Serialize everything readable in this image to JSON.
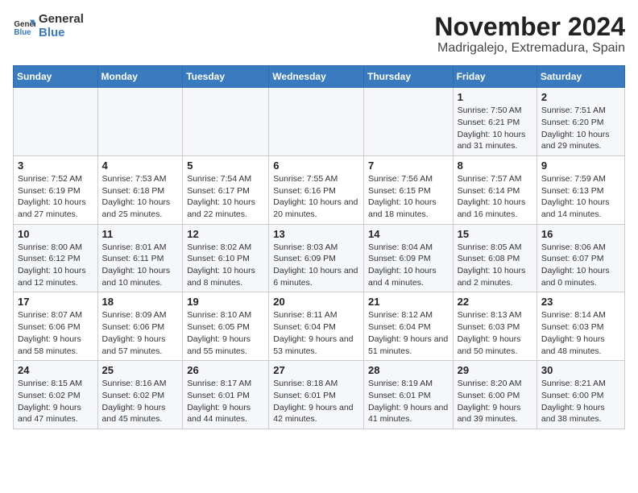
{
  "header": {
    "logo_general": "General",
    "logo_blue": "Blue",
    "title": "November 2024",
    "subtitle": "Madrigalejo, Extremadura, Spain"
  },
  "days_of_week": [
    "Sunday",
    "Monday",
    "Tuesday",
    "Wednesday",
    "Thursday",
    "Friday",
    "Saturday"
  ],
  "weeks": [
    [
      {
        "day": "",
        "info": ""
      },
      {
        "day": "",
        "info": ""
      },
      {
        "day": "",
        "info": ""
      },
      {
        "day": "",
        "info": ""
      },
      {
        "day": "",
        "info": ""
      },
      {
        "day": "1",
        "info": "Sunrise: 7:50 AM\nSunset: 6:21 PM\nDaylight: 10 hours and 31 minutes."
      },
      {
        "day": "2",
        "info": "Sunrise: 7:51 AM\nSunset: 6:20 PM\nDaylight: 10 hours and 29 minutes."
      }
    ],
    [
      {
        "day": "3",
        "info": "Sunrise: 7:52 AM\nSunset: 6:19 PM\nDaylight: 10 hours and 27 minutes."
      },
      {
        "day": "4",
        "info": "Sunrise: 7:53 AM\nSunset: 6:18 PM\nDaylight: 10 hours and 25 minutes."
      },
      {
        "day": "5",
        "info": "Sunrise: 7:54 AM\nSunset: 6:17 PM\nDaylight: 10 hours and 22 minutes."
      },
      {
        "day": "6",
        "info": "Sunrise: 7:55 AM\nSunset: 6:16 PM\nDaylight: 10 hours and 20 minutes."
      },
      {
        "day": "7",
        "info": "Sunrise: 7:56 AM\nSunset: 6:15 PM\nDaylight: 10 hours and 18 minutes."
      },
      {
        "day": "8",
        "info": "Sunrise: 7:57 AM\nSunset: 6:14 PM\nDaylight: 10 hours and 16 minutes."
      },
      {
        "day": "9",
        "info": "Sunrise: 7:59 AM\nSunset: 6:13 PM\nDaylight: 10 hours and 14 minutes."
      }
    ],
    [
      {
        "day": "10",
        "info": "Sunrise: 8:00 AM\nSunset: 6:12 PM\nDaylight: 10 hours and 12 minutes."
      },
      {
        "day": "11",
        "info": "Sunrise: 8:01 AM\nSunset: 6:11 PM\nDaylight: 10 hours and 10 minutes."
      },
      {
        "day": "12",
        "info": "Sunrise: 8:02 AM\nSunset: 6:10 PM\nDaylight: 10 hours and 8 minutes."
      },
      {
        "day": "13",
        "info": "Sunrise: 8:03 AM\nSunset: 6:09 PM\nDaylight: 10 hours and 6 minutes."
      },
      {
        "day": "14",
        "info": "Sunrise: 8:04 AM\nSunset: 6:09 PM\nDaylight: 10 hours and 4 minutes."
      },
      {
        "day": "15",
        "info": "Sunrise: 8:05 AM\nSunset: 6:08 PM\nDaylight: 10 hours and 2 minutes."
      },
      {
        "day": "16",
        "info": "Sunrise: 8:06 AM\nSunset: 6:07 PM\nDaylight: 10 hours and 0 minutes."
      }
    ],
    [
      {
        "day": "17",
        "info": "Sunrise: 8:07 AM\nSunset: 6:06 PM\nDaylight: 9 hours and 58 minutes."
      },
      {
        "day": "18",
        "info": "Sunrise: 8:09 AM\nSunset: 6:06 PM\nDaylight: 9 hours and 57 minutes."
      },
      {
        "day": "19",
        "info": "Sunrise: 8:10 AM\nSunset: 6:05 PM\nDaylight: 9 hours and 55 minutes."
      },
      {
        "day": "20",
        "info": "Sunrise: 8:11 AM\nSunset: 6:04 PM\nDaylight: 9 hours and 53 minutes."
      },
      {
        "day": "21",
        "info": "Sunrise: 8:12 AM\nSunset: 6:04 PM\nDaylight: 9 hours and 51 minutes."
      },
      {
        "day": "22",
        "info": "Sunrise: 8:13 AM\nSunset: 6:03 PM\nDaylight: 9 hours and 50 minutes."
      },
      {
        "day": "23",
        "info": "Sunrise: 8:14 AM\nSunset: 6:03 PM\nDaylight: 9 hours and 48 minutes."
      }
    ],
    [
      {
        "day": "24",
        "info": "Sunrise: 8:15 AM\nSunset: 6:02 PM\nDaylight: 9 hours and 47 minutes."
      },
      {
        "day": "25",
        "info": "Sunrise: 8:16 AM\nSunset: 6:02 PM\nDaylight: 9 hours and 45 minutes."
      },
      {
        "day": "26",
        "info": "Sunrise: 8:17 AM\nSunset: 6:01 PM\nDaylight: 9 hours and 44 minutes."
      },
      {
        "day": "27",
        "info": "Sunrise: 8:18 AM\nSunset: 6:01 PM\nDaylight: 9 hours and 42 minutes."
      },
      {
        "day": "28",
        "info": "Sunrise: 8:19 AM\nSunset: 6:01 PM\nDaylight: 9 hours and 41 minutes."
      },
      {
        "day": "29",
        "info": "Sunrise: 8:20 AM\nSunset: 6:00 PM\nDaylight: 9 hours and 39 minutes."
      },
      {
        "day": "30",
        "info": "Sunrise: 8:21 AM\nSunset: 6:00 PM\nDaylight: 9 hours and 38 minutes."
      }
    ]
  ]
}
